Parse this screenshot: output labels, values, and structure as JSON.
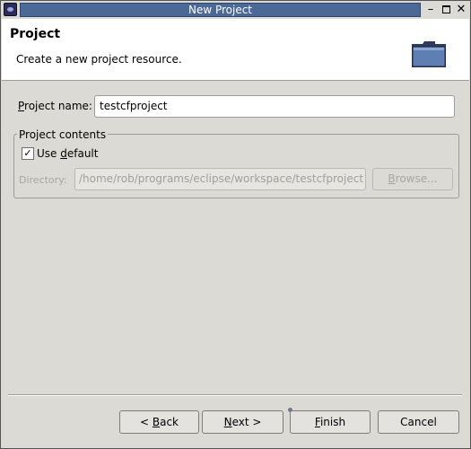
{
  "window": {
    "title": "New Project",
    "controls": {
      "minimize": "–",
      "maximize": "□",
      "close": "✕"
    }
  },
  "banner": {
    "title": "Project",
    "description": "Create a new project resource.",
    "icon": "folder-icon"
  },
  "form": {
    "project_name_label_prefix": "P",
    "project_name_label_rest": "roject name:",
    "project_name_value": "testcfproject",
    "group_title": "Project contents",
    "use_default_label_prefix": "Use ",
    "use_default_label_mnemonic": "d",
    "use_default_label_rest": "efault",
    "use_default_checked": true,
    "directory_label": "Directory:",
    "directory_value": "/home/rob/programs/eclipse/workspace/testcfproject",
    "browse_label_prefix": "B",
    "browse_label_rest": "rowse..."
  },
  "buttons": {
    "back_prefix": "< ",
    "back_mnemonic": "B",
    "back_rest": "ack",
    "next_mnemonic": "N",
    "next_rest": "ext >",
    "finish_mnemonic": "F",
    "finish_rest": "inish",
    "cancel": "Cancel"
  },
  "colors": {
    "title_bar_active": "#4b6997",
    "dialog_background": "#dcdad5",
    "banner_background": "#ffffff"
  }
}
